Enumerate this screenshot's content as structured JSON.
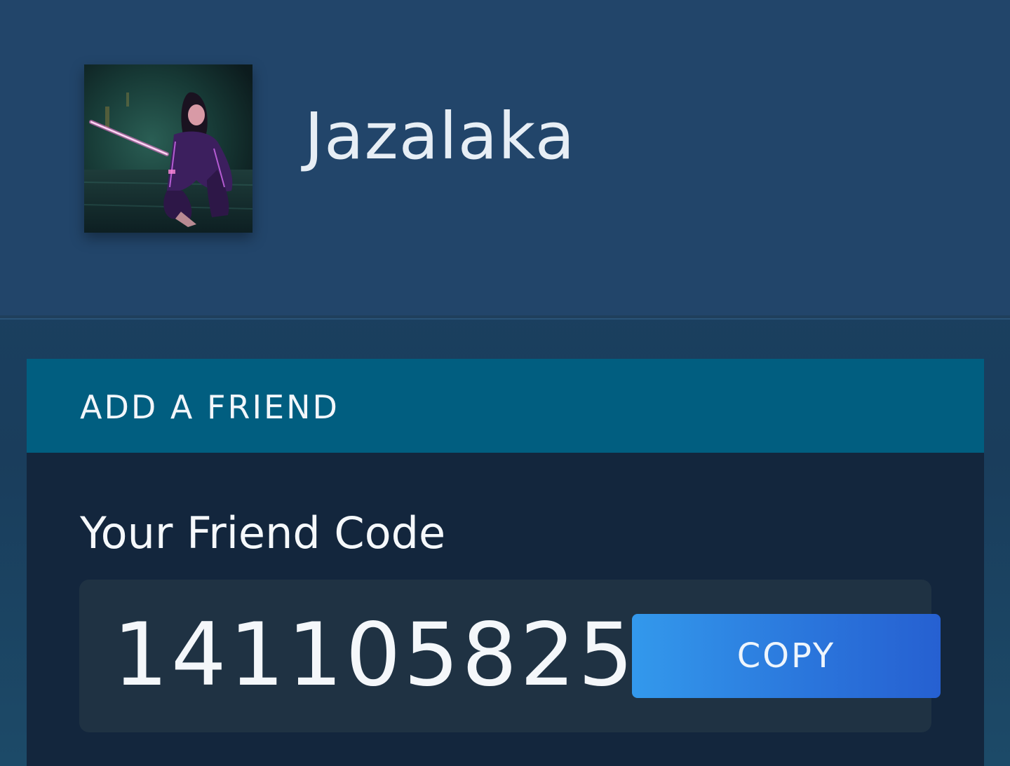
{
  "profile": {
    "username": "Jazalaka",
    "avatar_icon": "user-avatar-image"
  },
  "add_friend": {
    "title": "ADD A FRIEND",
    "friend_code_label": "Your Friend Code",
    "friend_code": "141105825",
    "copy_label": "COPY"
  },
  "colors": {
    "header_bg": "#22456a",
    "panel_header_bg": "#015e80",
    "panel_bg": "#13263d",
    "code_box_bg": "#1f3243",
    "button_start": "#3399ec",
    "button_end": "#2660d1"
  }
}
